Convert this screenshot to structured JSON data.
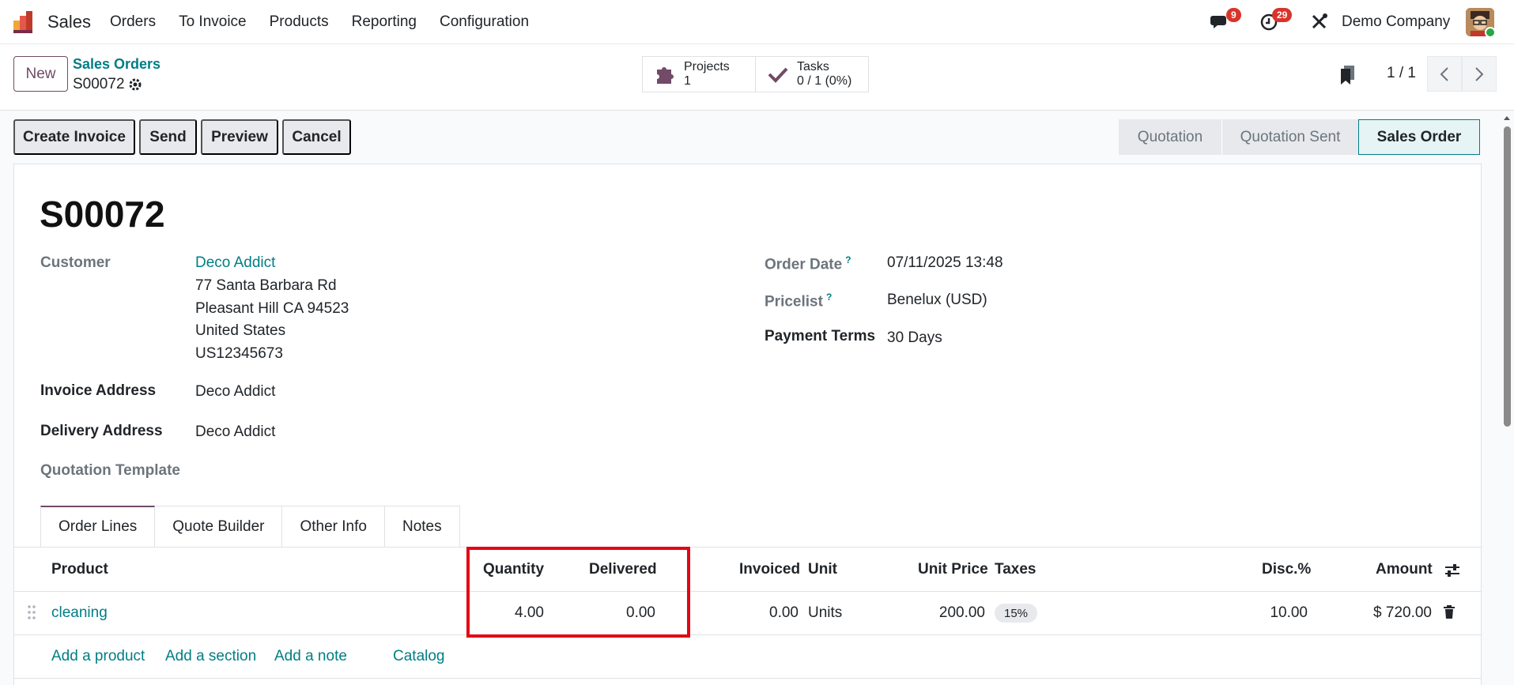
{
  "navbar": {
    "app_name": "Sales",
    "menu": [
      "Orders",
      "To Invoice",
      "Products",
      "Reporting",
      "Configuration"
    ],
    "messages_badge": "9",
    "activities_badge": "29",
    "company": "Demo Company"
  },
  "control_panel": {
    "new_label": "New",
    "breadcrumb": "Sales Orders",
    "record": "S00072",
    "smart_buttons": [
      {
        "label": "Projects",
        "value": "1"
      },
      {
        "label": "Tasks",
        "value": "0 / 1 (0%)"
      }
    ],
    "pager": "1 / 1"
  },
  "actions": [
    "Create Invoice",
    "Send",
    "Preview",
    "Cancel"
  ],
  "status_steps": [
    "Quotation",
    "Quotation Sent",
    "Sales Order"
  ],
  "status_active": "Sales Order",
  "form": {
    "title": "S00072",
    "customer_label": "Customer",
    "customer_name": "Deco Addict",
    "customer_address": [
      "77 Santa Barbara Rd",
      "Pleasant Hill CA 94523",
      "United States",
      "US12345673"
    ],
    "invoice_address_label": "Invoice Address",
    "invoice_address": "Deco Addict",
    "delivery_address_label": "Delivery Address",
    "delivery_address": "Deco Addict",
    "quotation_template_label": "Quotation Template",
    "order_date_label": "Order Date",
    "order_date": "07/11/2025 13:48",
    "pricelist_label": "Pricelist",
    "pricelist": "Benelux (USD)",
    "payment_terms_label": "Payment Terms",
    "payment_terms": "30 Days",
    "help_mark": "?"
  },
  "tabs": [
    "Order Lines",
    "Quote Builder",
    "Other Info",
    "Notes"
  ],
  "table": {
    "headers": {
      "product": "Product",
      "quantity": "Quantity",
      "delivered": "Delivered",
      "invoiced": "Invoiced",
      "unit": "Unit",
      "unit_price": "Unit Price",
      "taxes": "Taxes",
      "disc": "Disc.%",
      "amount": "Amount"
    },
    "row": {
      "product": "cleaning",
      "quantity": "4.00",
      "delivered": "0.00",
      "invoiced": "0.00",
      "unit": "Units",
      "unit_price": "200.00",
      "taxes": "15%",
      "disc": "10.00",
      "amount": "$ 720.00"
    },
    "add_links": [
      "Add a product",
      "Add a section",
      "Add a note",
      "Catalog"
    ]
  },
  "colors": {
    "brand": "#714b67",
    "link": "#017e84",
    "highlight": "#e30613"
  }
}
